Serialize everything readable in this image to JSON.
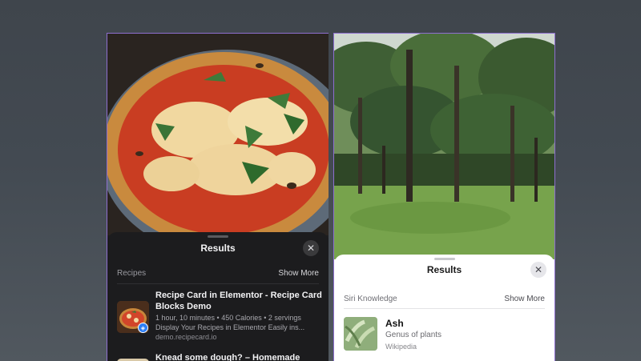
{
  "left_panel": {
    "sheet": {
      "title": "Results",
      "close_icon": "close-icon",
      "section_label": "Recipes",
      "show_more": "Show More"
    },
    "recipe": {
      "title": "Recipe Card in Elementor - Recipe Card Blocks Demo",
      "meta": "1 hour, 10 minutes • 450 Calories • 2 servings",
      "description": "Display Your Recipes in Elementor Easily ins...",
      "domain": "demo.recipecard.io",
      "badge_icon": "safari-icon"
    },
    "next_result_title": "Knead some dough? – Homemade"
  },
  "right_panel": {
    "sheet": {
      "title": "Results",
      "close_icon": "close-icon",
      "section_label": "Siri Knowledge",
      "show_more": "Show More"
    },
    "knowledge": {
      "title": "Ash",
      "subtitle": "Genus of plants",
      "source": "Wikipedia"
    }
  },
  "colors": {
    "accent_border": "#8e6fd0",
    "dark_sheet": "#1c1c1e",
    "light_sheet": "#ffffff"
  }
}
